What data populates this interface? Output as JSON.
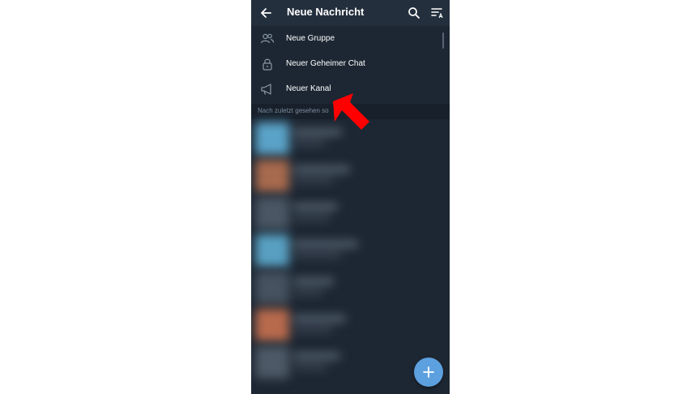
{
  "appbar": {
    "title": "Neue Nachricht",
    "back_icon": "arrow-left-icon",
    "search_icon": "search-icon",
    "sort_icon": "sort-az-icon"
  },
  "menu": {
    "items": [
      {
        "label": "Neue Gruppe",
        "icon": "group-icon"
      },
      {
        "label": "Neuer Geheimer Chat",
        "icon": "lock-icon"
      },
      {
        "label": "Neuer Kanal",
        "icon": "megaphone-icon"
      }
    ]
  },
  "section": {
    "header": "Nach zuletzt gesehen so"
  },
  "fab": {
    "icon": "plus-icon"
  },
  "annotation": {
    "icon": "red-pointer-arrow-icon",
    "color": "#ff0000"
  },
  "colors": {
    "background": "#1d2733",
    "appbar": "#232f3d",
    "section_header": "#17202b",
    "accent": "#5da0df"
  }
}
